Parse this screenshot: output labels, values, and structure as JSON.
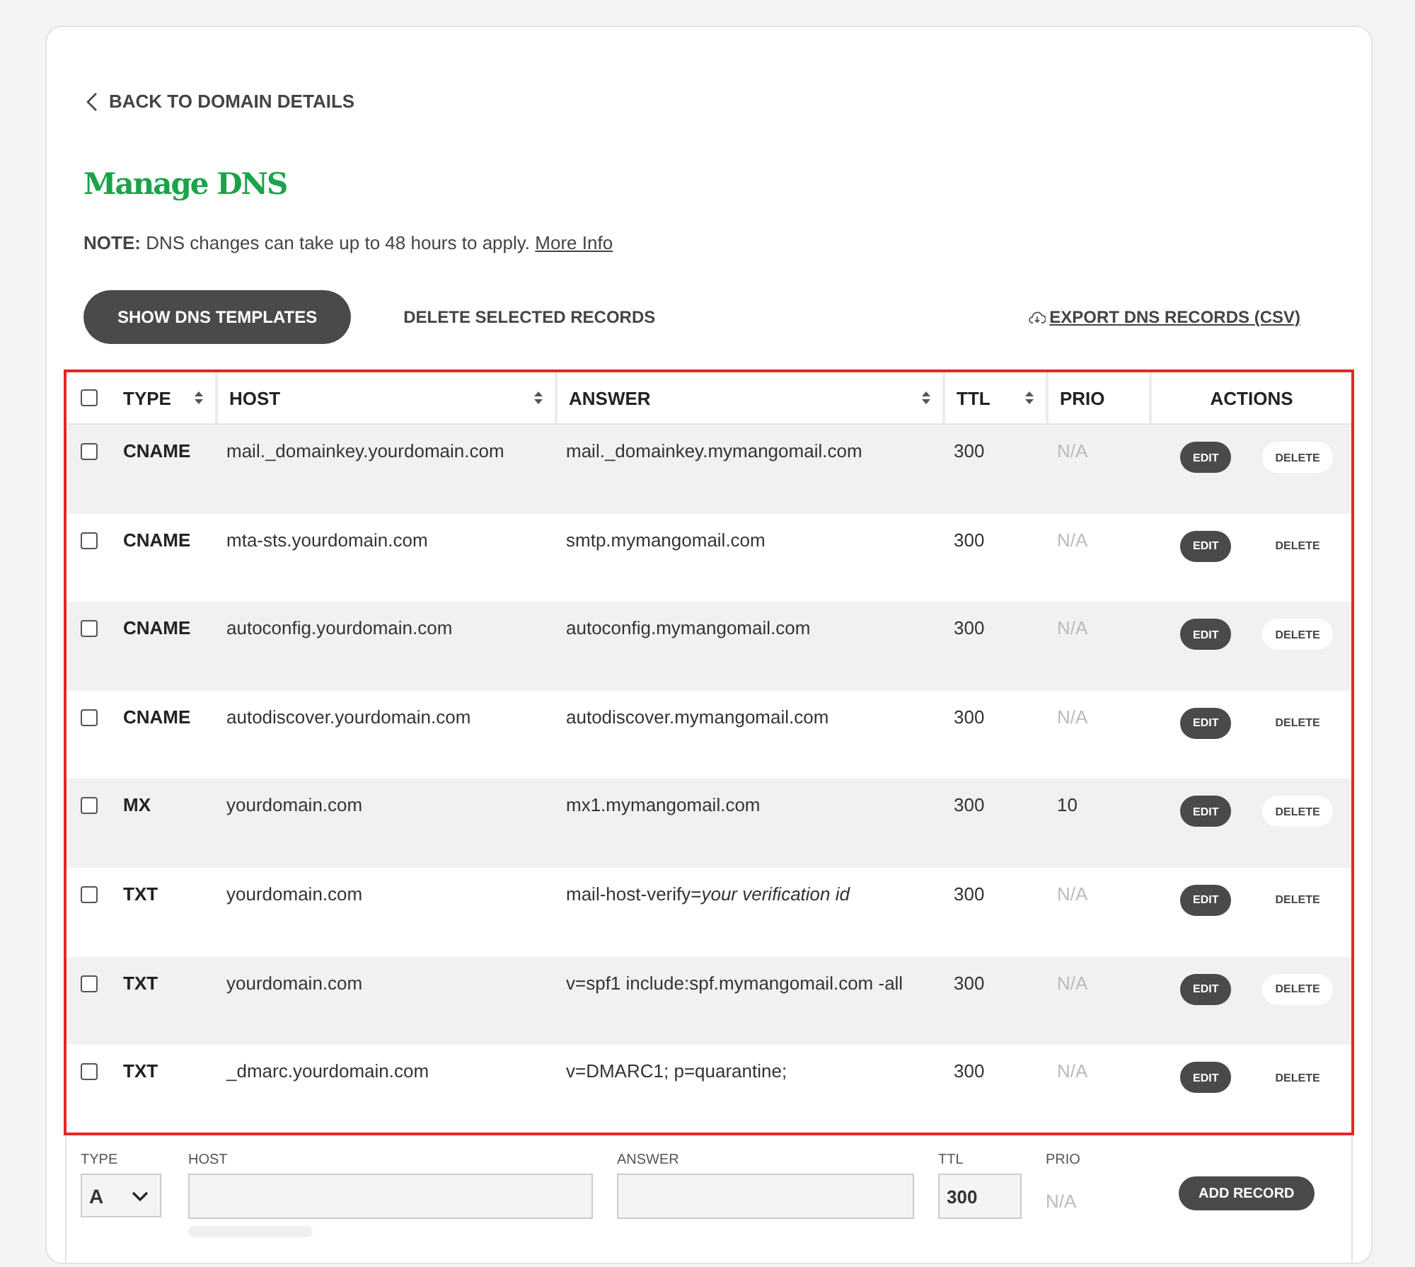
{
  "back_link": {
    "label": "BACK TO DOMAIN DETAILS"
  },
  "title": "Manage DNS",
  "note": {
    "text": "**NOTE:** DNS changes can take up to 48 hours to apply.",
    "link": "More Info"
  },
  "toolbar": {
    "primary_button": "SHOW DNS TEMPLATES",
    "secondary_button": "DELETE SELECTED RECORDS",
    "export_link": "EXPORT DNS RECORDS (CSV)"
  },
  "table": {
    "select_all": {
      "checked": false
    },
    "columns": [
      {
        "label": "TYPE",
        "sortable": true
      },
      {
        "label": "HOST",
        "sortable": true
      },
      {
        "label": "ANSWER",
        "sortable": true
      },
      {
        "label": "TTL",
        "sortable": true
      },
      {
        "label": "PRIO",
        "sortable": false
      },
      {
        "label": "ACTIONS",
        "sortable": false
      }
    ],
    "rows": [
      {
        "checked": false,
        "type": "CNAME",
        "host": "mail._domainkey.yourdomain.com",
        "answer": "mail._domainkey.mymangomail.com",
        "ttl": "300",
        "prio": "N/A",
        "prio_muted": true,
        "edit": "EDIT",
        "delete": "DELETE"
      },
      {
        "checked": false,
        "type": "CNAME",
        "host": "mta-sts.yourdomain.com",
        "answer": "smtp.mymangomail.com",
        "ttl": "300",
        "prio": "N/A",
        "prio_muted": true,
        "edit": "EDIT",
        "delete": "DELETE"
      },
      {
        "checked": false,
        "type": "CNAME",
        "host": "autoconfig.yourdomain.com",
        "answer": "autoconfig.mymangomail.com",
        "ttl": "300",
        "prio": "N/A",
        "prio_muted": true,
        "edit": "EDIT",
        "delete": "DELETE"
      },
      {
        "checked": false,
        "type": "CNAME",
        "host": "autodiscover.yourdomain.com",
        "answer": "autodiscover.mymangomail.com",
        "ttl": "300",
        "prio": "N/A",
        "prio_muted": true,
        "edit": "EDIT",
        "delete": "DELETE"
      },
      {
        "checked": false,
        "type": "MX",
        "host": "yourdomain.com",
        "answer": "mx1.mymangomail.com",
        "ttl": "300",
        "prio": "10",
        "prio_muted": false,
        "edit": "EDIT",
        "delete": "DELETE"
      },
      {
        "checked": false,
        "type": "TXT",
        "host": "yourdomain.com",
        "answer": "mail-host-verify=*your verification id*",
        "ttl": "300",
        "prio": "N/A",
        "prio_muted": true,
        "edit": "EDIT",
        "delete": "DELETE"
      },
      {
        "checked": false,
        "type": "TXT",
        "host": "yourdomain.com",
        "answer": "v=spf1 include:spf.mymangomail.com -all",
        "ttl": "300",
        "prio": "N/A",
        "prio_muted": true,
        "edit": "EDIT",
        "delete": "DELETE"
      },
      {
        "checked": false,
        "type": "TXT",
        "host": "_dmarc.yourdomain.com",
        "answer": "v=DMARC1; p=quarantine;",
        "ttl": "300",
        "prio": "N/A",
        "prio_muted": true,
        "edit": "EDIT",
        "delete": "DELETE"
      }
    ]
  },
  "add_form": {
    "type_label": "TYPE",
    "type_value": "A",
    "host_label": "HOST",
    "answer_label": "ANSWER",
    "ttl_label": "TTL",
    "ttl_value": "300",
    "prio_label": "PRIO",
    "prio_value": "N/A",
    "button": "ADD RECORD"
  }
}
